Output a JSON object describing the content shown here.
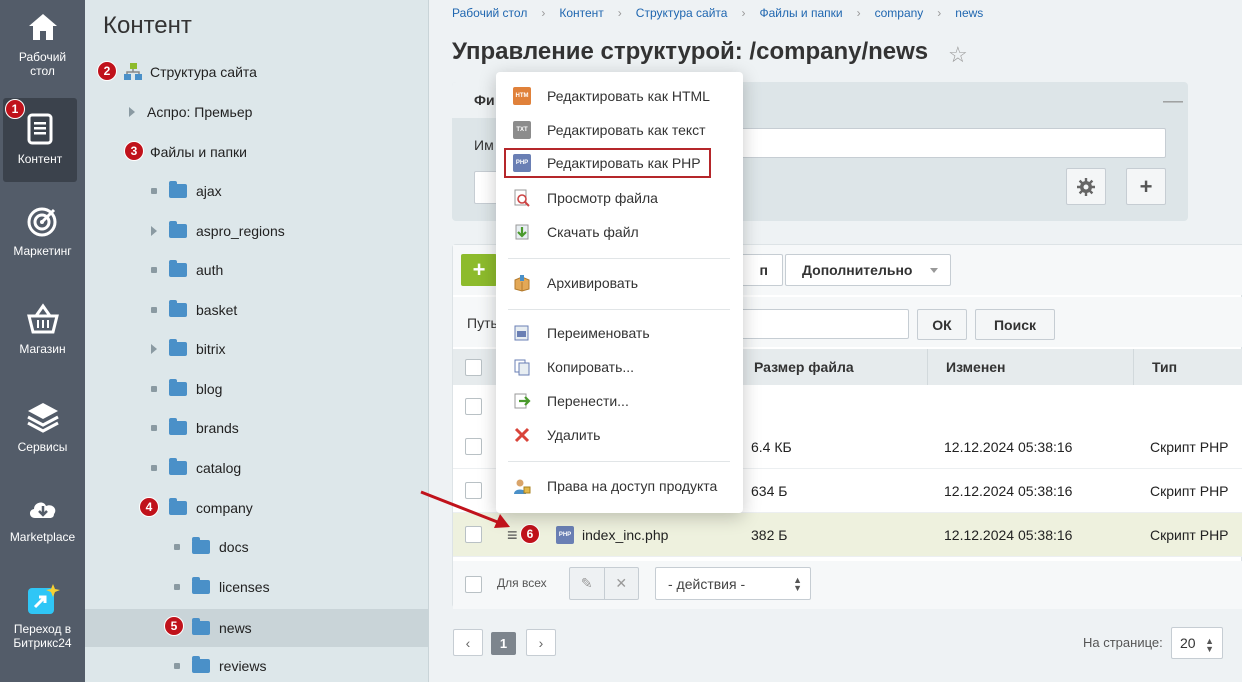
{
  "nav": {
    "items": [
      {
        "label1": "Рабочий",
        "label2": "стол"
      },
      {
        "label1": "Контент",
        "label2": ""
      },
      {
        "label1": "Маркетинг",
        "label2": ""
      },
      {
        "label1": "Магазин",
        "label2": ""
      },
      {
        "label1": "Сервисы",
        "label2": ""
      },
      {
        "label1": "Marketplace",
        "label2": ""
      },
      {
        "label1": "Переход в",
        "label2": "Битрикс24"
      }
    ]
  },
  "tree": {
    "title": "Контент",
    "items": [
      {
        "label": "Структура сайта"
      },
      {
        "label": "Аспро: Премьер"
      },
      {
        "label": "Файлы и папки"
      },
      {
        "label": "ajax"
      },
      {
        "label": "aspro_regions"
      },
      {
        "label": "auth"
      },
      {
        "label": "basket"
      },
      {
        "label": "bitrix"
      },
      {
        "label": "blog"
      },
      {
        "label": "brands"
      },
      {
        "label": "catalog"
      },
      {
        "label": "company"
      },
      {
        "label": "docs"
      },
      {
        "label": "licenses"
      },
      {
        "label": "news"
      },
      {
        "label": "reviews"
      }
    ]
  },
  "badges": [
    "1",
    "2",
    "3",
    "4",
    "5",
    "6"
  ],
  "breadcrumb": [
    "Рабочий стол",
    "Контент",
    "Структура сайта",
    "Файлы и папки",
    "company",
    "news"
  ],
  "page_title": "Управление структурой: /company/news",
  "filter": {
    "tab_label": "Фи",
    "name_label": "Им"
  },
  "toolbar": {
    "add": "+",
    "partial_button": "п",
    "more_button": "Дополнительно"
  },
  "pathbar": {
    "label": "Путь",
    "ok": "ОК",
    "search": "Поиск"
  },
  "table": {
    "columns": [
      "Размер файла",
      "Изменен",
      "Тип"
    ],
    "rows": [
      {
        "name": "",
        "size": "",
        "modified": "",
        "type": ""
      },
      {
        "name": "",
        "size": "6.4 КБ",
        "modified": "12.12.2024 05:38:16",
        "type": "Скрипт PHP"
      },
      {
        "name": "",
        "size": "634 Б",
        "modified": "12.12.2024 05:38:16",
        "type": "Скрипт PHP"
      },
      {
        "name": "index_inc.php",
        "size": "382 Б",
        "modified": "12.12.2024 05:38:16",
        "type": "Скрипт PHP"
      }
    ]
  },
  "footer": {
    "for_all": "Для всех",
    "actions": "- действия -"
  },
  "pager": {
    "prev": "‹",
    "current": "1",
    "next": "›",
    "per_page_label": "На странице:",
    "per_page_value": "20"
  },
  "context_menu": {
    "items": [
      {
        "label": "Редактировать как HTML",
        "icon": "html-file-icon"
      },
      {
        "label": "Редактировать как текст",
        "icon": "txt-file-icon"
      },
      {
        "label": "Редактировать как PHP",
        "icon": "php-file-icon"
      },
      {
        "label": "Просмотр файла",
        "icon": "view-file-icon"
      },
      {
        "label": "Скачать файл",
        "icon": "download-icon"
      },
      {
        "label": "Архивировать",
        "icon": "archive-icon"
      },
      {
        "label": "Переименовать",
        "icon": "rename-icon"
      },
      {
        "label": "Копировать...",
        "icon": "copy-icon"
      },
      {
        "label": "Перенести...",
        "icon": "move-icon"
      },
      {
        "label": "Удалить",
        "icon": "delete-icon"
      },
      {
        "label": "Права на доступ продукта",
        "icon": "access-rights-icon"
      }
    ]
  },
  "colors": {
    "nav_bg": "#535c69",
    "tree_bg": "#dde7ea",
    "accent_badge": "#c0121b",
    "add_button": "#8dbb2c",
    "highlight_row": "#eef1de",
    "menu_highlight_border": "#b5262a"
  }
}
